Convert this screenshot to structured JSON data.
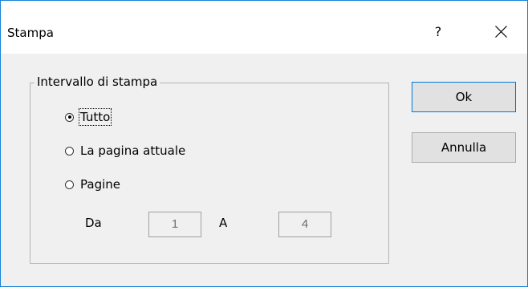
{
  "window": {
    "title": "Stampa",
    "help_label": "?"
  },
  "print_range": {
    "legend": "Intervallo di stampa",
    "options": [
      {
        "label": "Tutto",
        "selected": true
      },
      {
        "label": "La pagina attuale",
        "selected": false
      },
      {
        "label": "Pagine",
        "selected": false
      }
    ],
    "from_label": "Da",
    "from_value": "1",
    "to_label": "A",
    "to_value": "4"
  },
  "buttons": {
    "ok_label": "Ok",
    "cancel_label": "Annulla"
  },
  "icons": {
    "close": "close-icon"
  }
}
